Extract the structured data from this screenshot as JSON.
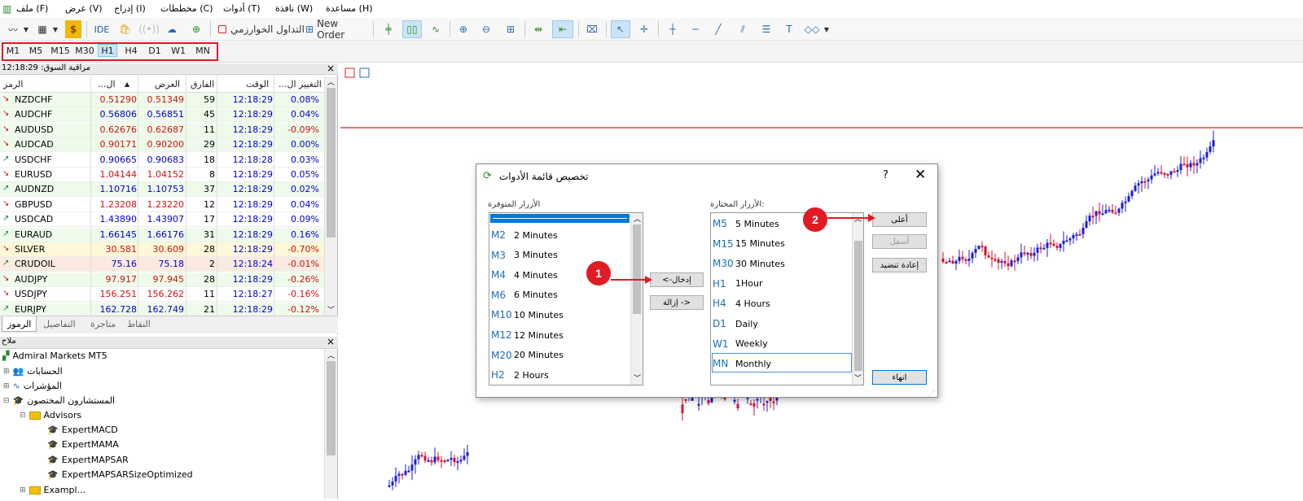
{
  "menu": [
    "ملف (F)",
    "عرض (V)",
    "إدراج (I)",
    "مخططات (C)",
    "أدوات (T)",
    "نافذة (W)",
    "مساعدة (H)"
  ],
  "toolbar": {
    "ide": "IDE",
    "algo_trading": "التداول الخوارزمي",
    "new_order": "New Order"
  },
  "timeframes": [
    "M1",
    "M5",
    "M15",
    "M30",
    "H1",
    "H4",
    "D1",
    "W1",
    "MN"
  ],
  "timeframe_active": "H1",
  "market_watch": {
    "title": "مراقبة السوق: 12:18:29",
    "columns": {
      "symbol": "الرمز",
      "bid": "...ال",
      "ask": "العرض",
      "spread": "الفارق",
      "time": "الوقت",
      "change": "...التغيير ال"
    },
    "rows": [
      {
        "symbol": "NZDCHF",
        "dir": "down",
        "bid": "0.51290",
        "ask": "0.51349",
        "spread": "59",
        "time": "12:18:29",
        "change": "0.08%",
        "bid_color": "#d01010",
        "chg_color": "#0000d0",
        "bg": "#eefbea"
      },
      {
        "symbol": "AUDCHF",
        "dir": "down",
        "bid": "0.56806",
        "ask": "0.56851",
        "spread": "45",
        "time": "12:18:29",
        "change": "0.04%",
        "bid_color": "#0000d0",
        "chg_color": "#0000d0",
        "bg": "#eefbea"
      },
      {
        "symbol": "AUDUSD",
        "dir": "down",
        "bid": "0.62676",
        "ask": "0.62687",
        "spread": "11",
        "time": "12:18:29",
        "change": "-0.09%",
        "bid_color": "#d01010",
        "chg_color": "#d01010",
        "bg": "#eefbea"
      },
      {
        "symbol": "AUDCAD",
        "dir": "down",
        "bid": "0.90171",
        "ask": "0.90200",
        "spread": "29",
        "time": "12:18:29",
        "change": "0.00%",
        "bid_color": "#d01010",
        "chg_color": "#0000d0",
        "bg": "#eefbea"
      },
      {
        "symbol": "USDCHF",
        "dir": "up",
        "bid": "0.90665",
        "ask": "0.90683",
        "spread": "18",
        "time": "12:18:28",
        "change": "0.03%",
        "bid_color": "#0000d0",
        "chg_color": "#0000d0",
        "bg": "#ffffff"
      },
      {
        "symbol": "EURUSD",
        "dir": "down",
        "bid": "1.04144",
        "ask": "1.04152",
        "spread": "8",
        "time": "12:18:29",
        "change": "0.05%",
        "bid_color": "#d01010",
        "chg_color": "#0000d0",
        "bg": "#ffffff"
      },
      {
        "symbol": "AUDNZD",
        "dir": "up",
        "bid": "1.10716",
        "ask": "1.10753",
        "spread": "37",
        "time": "12:18:29",
        "change": "0.02%",
        "bid_color": "#0000d0",
        "chg_color": "#0000d0",
        "bg": "#eefbea"
      },
      {
        "symbol": "GBPUSD",
        "dir": "down",
        "bid": "1.23208",
        "ask": "1.23220",
        "spread": "12",
        "time": "12:18:29",
        "change": "0.04%",
        "bid_color": "#d01010",
        "chg_color": "#0000d0",
        "bg": "#ffffff"
      },
      {
        "symbol": "USDCAD",
        "dir": "up",
        "bid": "1.43890",
        "ask": "1.43907",
        "spread": "17",
        "time": "12:18:29",
        "change": "0.09%",
        "bid_color": "#0000d0",
        "chg_color": "#0000d0",
        "bg": "#ffffff"
      },
      {
        "symbol": "EURAUD",
        "dir": "up",
        "bid": "1.66145",
        "ask": "1.66176",
        "spread": "31",
        "time": "12:18:29",
        "change": "0.16%",
        "bid_color": "#0000d0",
        "chg_color": "#0000d0",
        "bg": "#eefbea"
      },
      {
        "symbol": "SILVER",
        "dir": "down",
        "bid": "30.581",
        "ask": "30.609",
        "spread": "28",
        "time": "12:18:29",
        "change": "-0.70%",
        "bid_color": "#d01010",
        "chg_color": "#d01010",
        "bg": "#fff8d8"
      },
      {
        "symbol": "CRUDOIL",
        "dir": "up",
        "bid": "75.16",
        "ask": "75.18",
        "spread": "2",
        "time": "12:18:24",
        "change": "-0.01%",
        "bid_color": "#0000d0",
        "chg_color": "#d01010",
        "bg": "#fbeae0"
      },
      {
        "symbol": "AUDJPY",
        "dir": "down",
        "bid": "97.917",
        "ask": "97.945",
        "spread": "28",
        "time": "12:18:29",
        "change": "-0.26%",
        "bid_color": "#d01010",
        "chg_color": "#d01010",
        "bg": "#eefbea"
      },
      {
        "symbol": "USDJPY",
        "dir": "down",
        "bid": "156.251",
        "ask": "156.262",
        "spread": "11",
        "time": "12:18:27",
        "change": "-0.16%",
        "bid_color": "#d01010",
        "chg_color": "#d01010",
        "bg": "#ffffff"
      },
      {
        "symbol": "EURJPY",
        "dir": "up",
        "bid": "162.728",
        "ask": "162.749",
        "spread": "21",
        "time": "12:18:29",
        "change": "-0.12%",
        "bid_color": "#0000d0",
        "chg_color": "#d01010",
        "bg": "#eefbea"
      }
    ],
    "tabs": [
      "الرموز",
      "التفاصيل",
      "متاجرة",
      "النقاط"
    ]
  },
  "navigator": {
    "title": "ملاح",
    "root": "Admiral Markets MT5",
    "accounts": "الحسابات",
    "indicators": "المؤشرات",
    "experts": "المستشارون المختصون",
    "advisors_folder": "Advisors",
    "advisors": [
      "ExpertMACD",
      "ExpertMAMA",
      "ExpertMAPSAR",
      "ExpertMAPSARSizeOptimized"
    ],
    "partial": "Exampl..."
  },
  "dialog": {
    "title": "تخصيص قائمة الأدوات",
    "help": "?",
    "available_label": "الأزرار المتوفرة",
    "selected_label": "الأزرار المختارة:",
    "available": [
      {
        "code": "M2",
        "label": "2 Minutes"
      },
      {
        "code": "M3",
        "label": "3 Minutes"
      },
      {
        "code": "M4",
        "label": "4 Minutes"
      },
      {
        "code": "M6",
        "label": "6 Minutes"
      },
      {
        "code": "M10",
        "label": "10 Minutes"
      },
      {
        "code": "M12",
        "label": "12 Minutes"
      },
      {
        "code": "M20",
        "label": "20 Minutes"
      },
      {
        "code": "H2",
        "label": "2 Hours"
      }
    ],
    "selected": [
      {
        "code": "M5",
        "label": "5 Minutes"
      },
      {
        "code": "M15",
        "label": "15 Minutes"
      },
      {
        "code": "M30",
        "label": "30 Minutes"
      },
      {
        "code": "H1",
        "label": "1Hour"
      },
      {
        "code": "H4",
        "label": "4 Hours"
      },
      {
        "code": "D1",
        "label": "Daily"
      },
      {
        "code": "W1",
        "label": "Weekly"
      },
      {
        "code": "MN",
        "label": "Monthly"
      }
    ],
    "insert_btn": "<-إدخال",
    "remove_btn": "إزالة ->",
    "up_btn": "أعلى",
    "down_btn": "أسفل",
    "reset_btn": "إعادة تنضيد",
    "finish_btn": "انهاء",
    "badge1": "1",
    "badge2": "2"
  },
  "colors": {
    "accent_red": "#e01b24",
    "bull": "#1c1cd8",
    "bear": "#d8102c",
    "price_line": "#e01b24"
  }
}
